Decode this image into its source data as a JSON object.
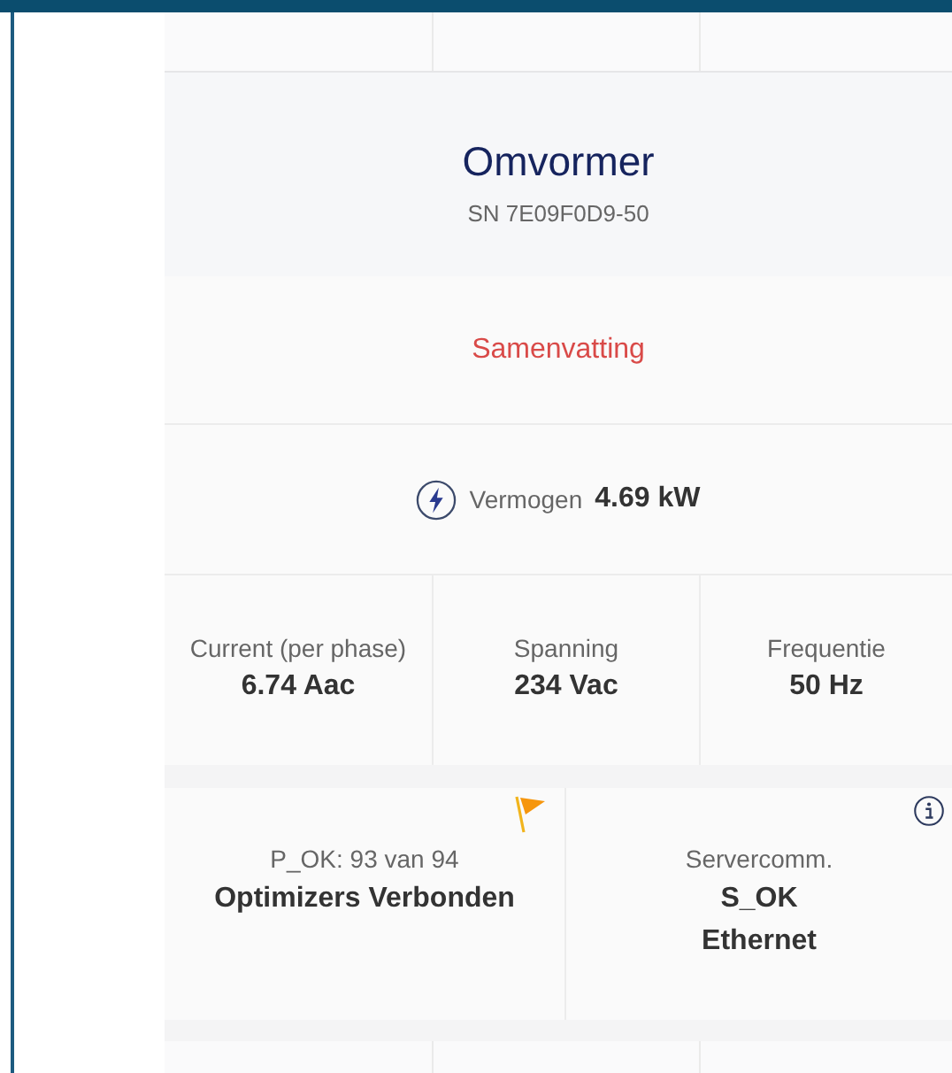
{
  "device": {
    "title": "Omvormer",
    "serial": "SN 7E09F0D9-50"
  },
  "section_link": "Samenvatting",
  "power": {
    "label": "Vermogen",
    "value": "4.69 kW"
  },
  "metrics": [
    {
      "label": "Current (per phase)",
      "value": "6.74 Aac"
    },
    {
      "label": "Spanning",
      "value": "234 Vac"
    },
    {
      "label": "Frequentie",
      "value": "50 Hz"
    }
  ],
  "status_cards": [
    {
      "kind": "flag",
      "label": "P_OK: 93 van 94",
      "values": [
        "Optimizers Verbonden"
      ]
    },
    {
      "kind": "info",
      "label": "Servercomm.",
      "values": [
        "S_OK",
        "Ethernet"
      ]
    }
  ]
}
